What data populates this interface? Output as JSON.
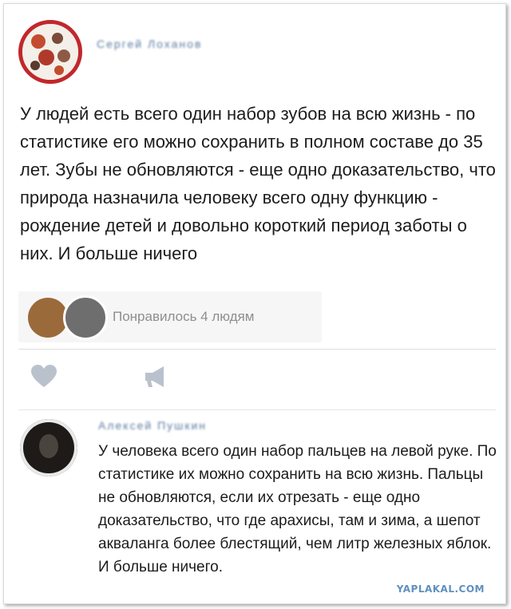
{
  "post": {
    "author_name": "Сергей Лоханов",
    "text": "У людей есть всего один набор зубов на всю жизнь - по статистике его можно сохранить в полном составе до 35 лет. Зубы не обновляются - еще одно доказательство, что природа назначила человеку всего одну функцию - рождение детей и довольно короткий период заботы о них. И больше ничего",
    "likes_text": "Понравилось 4 людям"
  },
  "icons": {
    "like": "heart-icon",
    "share": "megaphone-icon"
  },
  "comment": {
    "author_name": "Алексей Пушкин",
    "text": "У человека всего один набор пальцев на левой руке. По статистике их можно сохранить на всю жизнь. Пальцы не обновляются, если их отрезать - еще одно доказательство, что где арахисы, там и зима, а шепот акваланга более блестящий, чем литр железных яблок. И больше ничего."
  },
  "watermark": "YAPLAKAL.COM",
  "colors": {
    "link": "#5b7aa0",
    "muted": "#8e8e8e",
    "avatar_ring": "#c0282c",
    "watermark": "#5f90bf"
  }
}
